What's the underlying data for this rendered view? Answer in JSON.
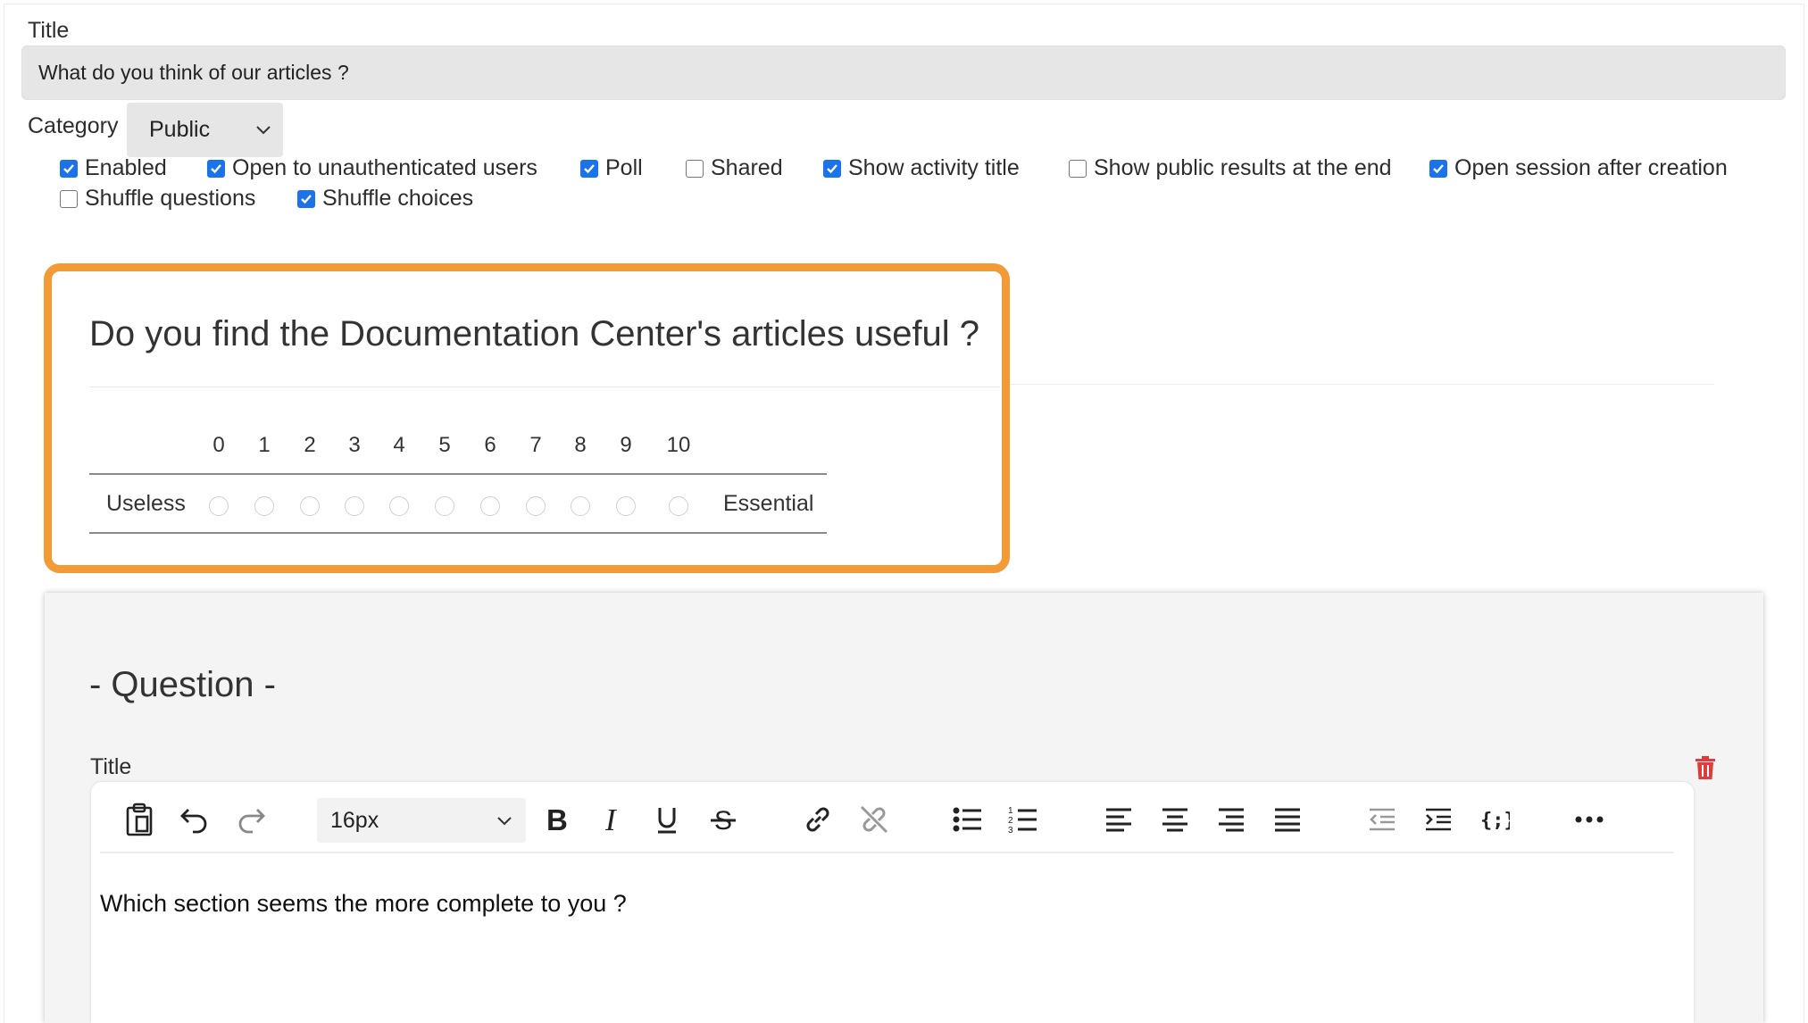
{
  "form": {
    "title_label": "Title",
    "title_value": "What do you think of our articles ?",
    "category_label": "Category",
    "category_value": "Public",
    "options": [
      {
        "label": "Enabled",
        "checked": true
      },
      {
        "label": "Open to unauthenticated users",
        "checked": true
      },
      {
        "label": "Poll",
        "checked": true
      },
      {
        "label": "Shared",
        "checked": false
      },
      {
        "label": "Show activity title",
        "checked": true
      },
      {
        "label": "Show public results at the end",
        "checked": false
      },
      {
        "label": "Open session after creation",
        "checked": true
      },
      {
        "label": "Shuffle questions",
        "checked": false
      },
      {
        "label": "Shuffle choices",
        "checked": true
      }
    ]
  },
  "preview": {
    "question": "Do you find the Documentation Center's articles useful ?",
    "scale": [
      "0",
      "1",
      "2",
      "3",
      "4",
      "5",
      "6",
      "7",
      "8",
      "9",
      "10"
    ],
    "min_label": "Useless",
    "max_label": "Essential"
  },
  "question_editor": {
    "heading": "- Question -",
    "title_label": "Title",
    "font_size": "16px",
    "content": "Which section seems the more complete to you ?",
    "toolbar_icons": [
      "paste-icon",
      "undo-icon",
      "redo-icon",
      "bold-icon",
      "italic-icon",
      "underline-icon",
      "strikethrough-icon",
      "link-icon",
      "unlink-icon",
      "bullet-list-icon",
      "numbered-list-icon",
      "align-left-icon",
      "align-center-icon",
      "align-right-icon",
      "justify-icon",
      "outdent-icon",
      "indent-icon",
      "code-icon",
      "more-icon"
    ]
  },
  "colors": {
    "highlight": "#f19a36",
    "checkbox": "#1a73e8",
    "trash": "#e03c3c"
  }
}
